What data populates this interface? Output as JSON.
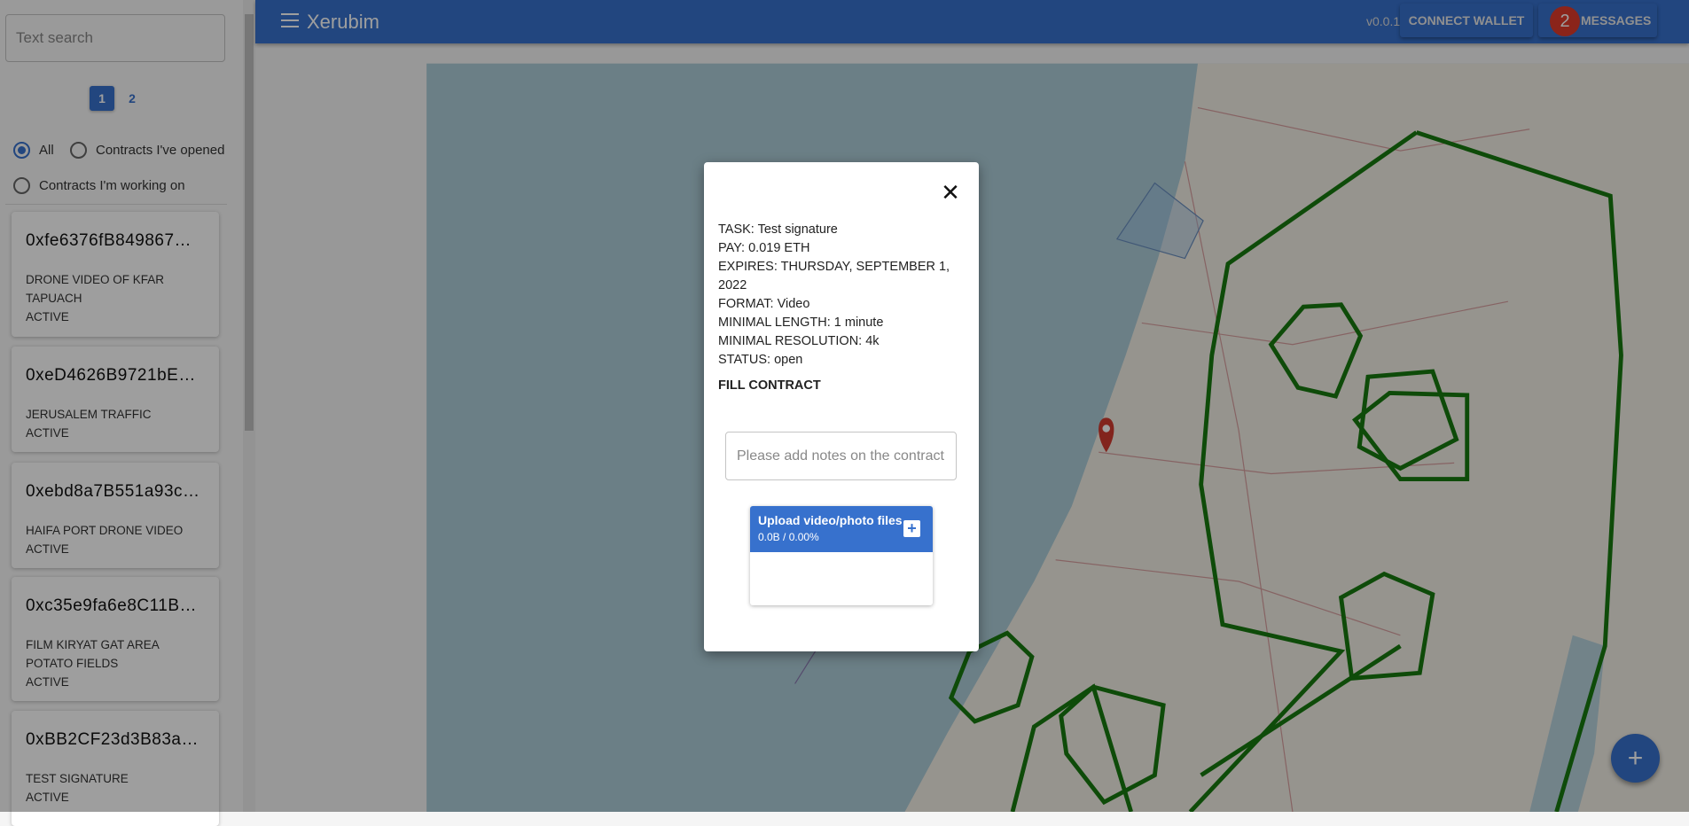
{
  "sidebar": {
    "search_placeholder": "Text search",
    "pages": [
      "1",
      "2"
    ],
    "filters": [
      "All",
      "Contracts I've opened",
      "Contracts I'm working on"
    ],
    "selected_filter": "All",
    "cards": [
      {
        "address": "0xfe6376fB849867…",
        "lines": [
          "DRONE VIDEO OF KFAR",
          "TAPUACH",
          "ACTIVE"
        ]
      },
      {
        "address": "0xeD4626B9721bEb…",
        "lines": [
          "JERUSALEM TRAFFIC",
          "ACTIVE"
        ]
      },
      {
        "address": "0xebd8a7B551a93c…",
        "lines": [
          "HAIFA PORT DRONE VIDEO",
          "ACTIVE"
        ]
      },
      {
        "address": "0xc35e9fa6e8C11B…",
        "lines": [
          "FILM KIRYAT GAT AREA",
          "POTATO FIELDS",
          "ACTIVE"
        ]
      },
      {
        "address": "0xBB2CF23d3B83a…",
        "lines": [
          "TEST SIGNATURE",
          "ACTIVE"
        ]
      }
    ]
  },
  "header": {
    "title": "Xerubim",
    "version": "v0.0.1",
    "connect_wallet": "CONNECT WALLET",
    "messages": "MESSAGES",
    "message_count": "2"
  },
  "modal": {
    "details": [
      "TASK: Test signature",
      "PAY: 0.019 ETH",
      "EXPIRES: THURSDAY, SEPTEMBER 1, 2022",
      "FORMAT: Video",
      "MINIMAL LENGTH: 1 minute",
      "MINIMAL RESOLUTION: 4k",
      "STATUS: open"
    ],
    "fill_contract": "FILL CONTRACT",
    "notes_placeholder": "Please add notes on the contract",
    "upload_title": "Upload video/photo files",
    "upload_progress": "0.0B / 0.00%"
  },
  "colors": {
    "accent": "#3771cd",
    "badge": "#e03a2a",
    "polygon": "#187a10",
    "marker": "#d23a2f"
  }
}
